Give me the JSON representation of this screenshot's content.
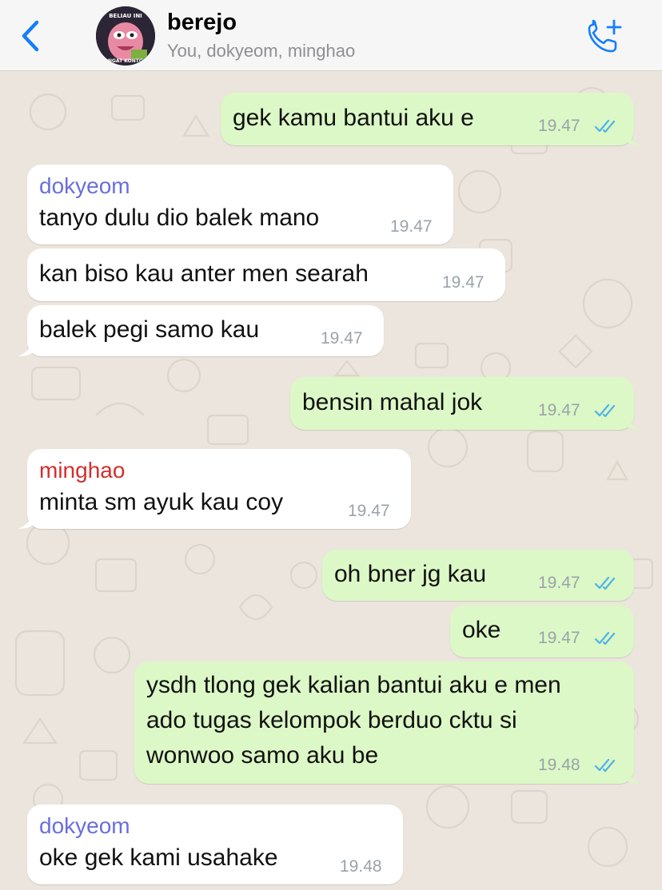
{
  "header": {
    "title": "berejo",
    "subtitle": "You, dokyeom, minghao",
    "avatar_caption_top": "BELIAU INI",
    "avatar_caption_bottom": "NGAT KONTO"
  },
  "colors": {
    "outgoing_bubble": "#dcf8c6",
    "incoming_bubble": "#ffffff",
    "accent_blue": "#147efb",
    "read_ticks": "#4fb3e8",
    "dokyeom_name": "#6a6fdc",
    "minghao_name": "#d42e2e"
  },
  "icons": {
    "back": "chevron-left-icon",
    "call": "add-call-icon",
    "read": "double-check-icon"
  },
  "messages": [
    {
      "direction": "out",
      "text": "gek kamu bantui aku e",
      "time": "19.47",
      "read": true
    },
    {
      "direction": "in",
      "sender": "dokyeom",
      "text": "tanyo dulu dio balek mano",
      "time": "19.47"
    },
    {
      "direction": "in",
      "text": "kan biso kau anter men searah",
      "time": "19.47"
    },
    {
      "direction": "in",
      "text": "balek pegi samo kau",
      "time": "19.47"
    },
    {
      "direction": "out",
      "text": "bensin mahal jok",
      "time": "19.47",
      "read": true
    },
    {
      "direction": "in",
      "sender": "minghao",
      "text": "minta sm ayuk kau coy",
      "time": "19.47"
    },
    {
      "direction": "out",
      "text": "oh bner jg kau",
      "time": "19.47",
      "read": true
    },
    {
      "direction": "out",
      "text": "oke",
      "time": "19.47",
      "read": true
    },
    {
      "direction": "out",
      "lines": [
        "ysdh tlong gek kalian bantui aku e men",
        "ado tugas kelompok berduo cktu si",
        "wonwoo samo aku be"
      ],
      "time": "19.48",
      "read": true
    },
    {
      "direction": "in",
      "sender": "dokyeom",
      "text": "oke gek kami usahake",
      "time": "19.48"
    }
  ]
}
